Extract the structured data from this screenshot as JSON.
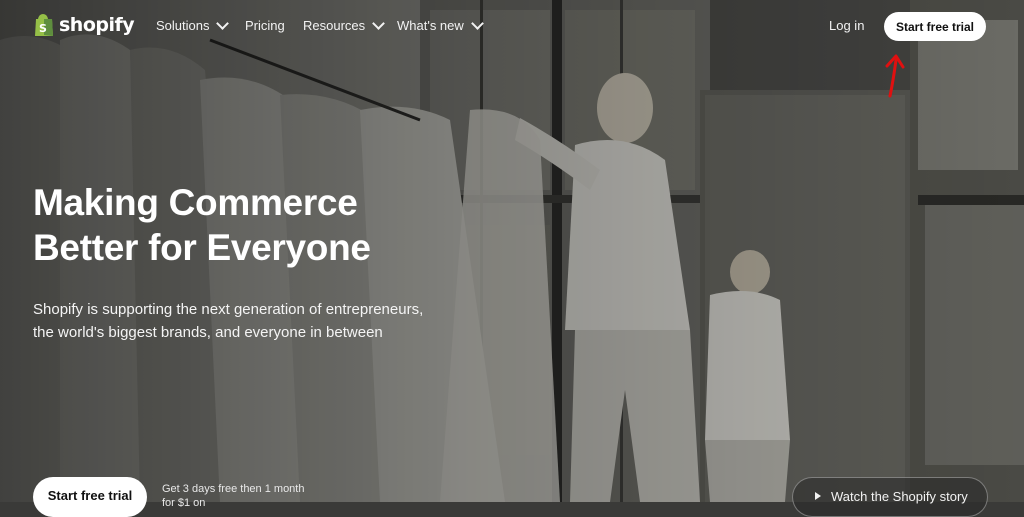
{
  "brand": {
    "name": "shopify",
    "logo_color": "#95bf47"
  },
  "nav": {
    "items": [
      {
        "label": "Solutions",
        "has_dropdown": true
      },
      {
        "label": "Pricing",
        "has_dropdown": false
      },
      {
        "label": "Resources",
        "has_dropdown": true
      },
      {
        "label": "What's new",
        "has_dropdown": true
      }
    ],
    "login_label": "Log in",
    "cta_label": "Start free trial"
  },
  "hero": {
    "title_line1": "Making Commerce",
    "title_line2": "Better for Everyone",
    "subtitle": "Shopify is supporting the next generation of entrepreneurs, the world's biggest brands, and everyone in between",
    "cta_label": "Start free trial",
    "offer_text": "Get 3 days free then 1 month for $1 on",
    "video_label": "Watch the Shopify story"
  },
  "annotation": {
    "color": "#e01010",
    "icon": "red-arrow-icon"
  }
}
